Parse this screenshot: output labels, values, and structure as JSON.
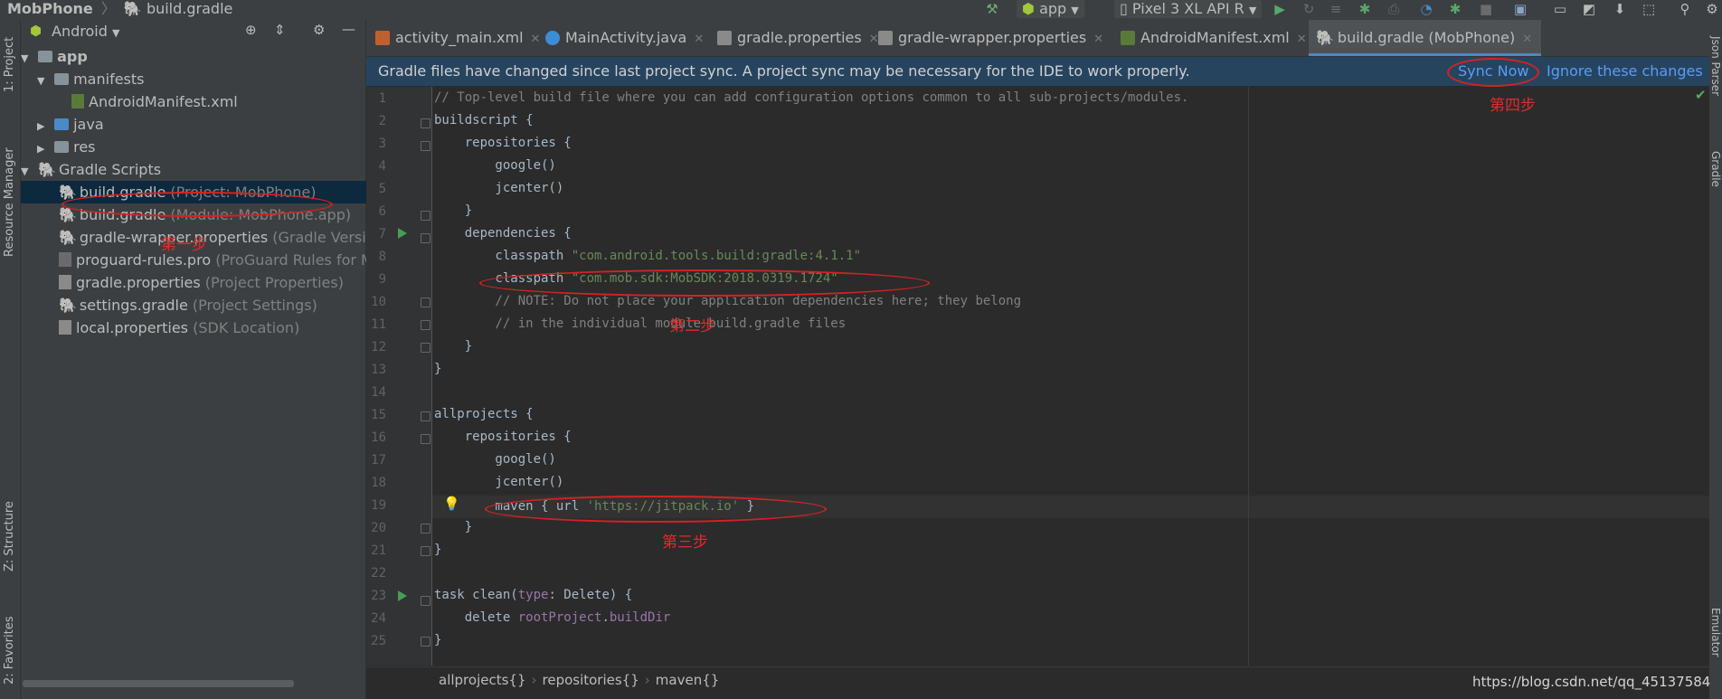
{
  "toolbar": {
    "project": "MobPhone",
    "file": "build.gradle",
    "run_config": "app",
    "device": "Pixel 3 XL API R"
  },
  "left_strip": {
    "project": "1: Project",
    "resource_manager": "Resource Manager",
    "structure": "Z: Structure",
    "favorites": "2: Favorites"
  },
  "right_strip": {
    "json_parser": "Json Parser",
    "gradle": "Gradle",
    "emulator": "Emulator"
  },
  "project_panel": {
    "view": "Android",
    "tree": [
      {
        "label": "app",
        "hint": ""
      },
      {
        "label": "manifests",
        "hint": ""
      },
      {
        "label": "AndroidManifest.xml",
        "hint": ""
      },
      {
        "label": "java",
        "hint": ""
      },
      {
        "label": "res",
        "hint": ""
      },
      {
        "label": "Gradle Scripts",
        "hint": ""
      },
      {
        "label": "build.gradle",
        "hint": " (Project: MobPhone)"
      },
      {
        "label": "build.gradle",
        "hint": " (Module: MobPhone.app)"
      },
      {
        "label": "gradle-wrapper.properties",
        "hint": " (Gradle Version"
      },
      {
        "label": "proguard-rules.pro",
        "hint": " (ProGuard Rules for Mo"
      },
      {
        "label": "gradle.properties",
        "hint": " (Project Properties)"
      },
      {
        "label": "settings.gradle",
        "hint": " (Project Settings)"
      },
      {
        "label": "local.properties",
        "hint": " (SDK Location)"
      }
    ]
  },
  "tabs": [
    {
      "label": "activity_main.xml"
    },
    {
      "label": "MainActivity.java"
    },
    {
      "label": "gradle.properties"
    },
    {
      "label": "gradle-wrapper.properties"
    },
    {
      "label": "AndroidManifest.xml"
    },
    {
      "label": "build.gradle (MobPhone)"
    }
  ],
  "banner": {
    "message": "Gradle files have changed since last project sync. A project sync may be necessary for the IDE to work properly.",
    "sync_now": "Sync Now",
    "ignore": "Ignore these changes"
  },
  "code": {
    "l1": "// Top-level build file where you can add configuration options common to all sub-projects/modules.",
    "l2": "buildscript {",
    "l3": "    repositories {",
    "l4": "        google()",
    "l5": "        jcenter()",
    "l6": "    }",
    "l7": "    dependencies {",
    "l8a": "        classpath ",
    "l8b": "\"com.android.tools.build:gradle:4.1.1\"",
    "l9a": "        classpath ",
    "l9b": "\"com.mob.sdk:MobSDK:2018.0319.1724\"",
    "l10": "        // NOTE: Do not place your application dependencies here; they belong",
    "l11": "        // in the individual module build.gradle files",
    "l12": "    }",
    "l13": "}",
    "l15": "allprojects {",
    "l16": "    repositories {",
    "l17": "        google()",
    "l18": "        jcenter()",
    "l19a": "        maven { url ",
    "l19b": "'https://jitpack.io'",
    "l19c": " }",
    "l20": "    }",
    "l21": "}",
    "l23a": "task clean(",
    "l23b": "type",
    "l23c": ": Delete) {",
    "l24a": "    delete ",
    "l24b": "rootProject",
    "l24c": ".",
    "l24d": "buildDir",
    "l25": "}"
  },
  "line_numbers": [
    "1",
    "2",
    "3",
    "4",
    "5",
    "6",
    "7",
    "8",
    "9",
    "10",
    "11",
    "12",
    "13",
    "14",
    "15",
    "16",
    "17",
    "18",
    "19",
    "20",
    "21",
    "22",
    "23",
    "24",
    "25"
  ],
  "breadcrumb": [
    "allprojects{}",
    "repositories{}",
    "maven{}"
  ],
  "watermark": "https://blog.csdn.net/qq_45137584",
  "annotations": {
    "step1": "第一步",
    "step2": "第二步",
    "step3": "第三步",
    "step4": "第四步"
  },
  "colors": {
    "accent": "#4a88c7",
    "annotation": "#d42222",
    "banner": "#27445f"
  }
}
